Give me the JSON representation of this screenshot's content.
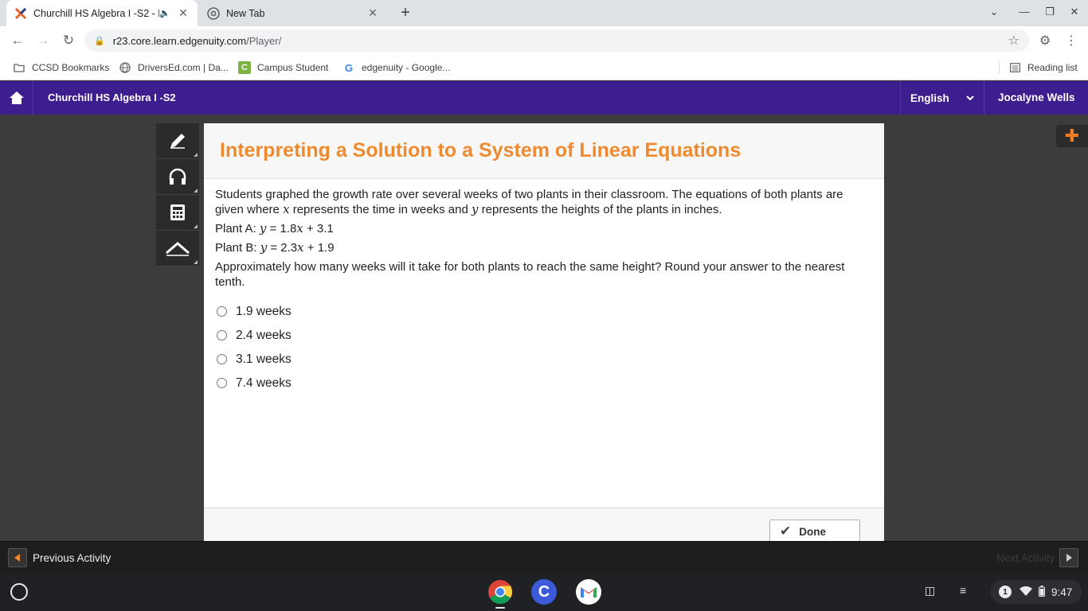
{
  "browser": {
    "tabs": [
      {
        "title": "Churchill HS Algebra I -S2 - E",
        "active": true
      },
      {
        "title": "New Tab",
        "active": false
      }
    ],
    "url_host": "r23.core.learn.edgenuity.com",
    "url_path": "/Player/",
    "bookmarks": [
      {
        "label": "CCSD Bookmarks",
        "icon": "folder-icon"
      },
      {
        "label": "DriversEd.com | Da...",
        "icon": "globe-icon"
      },
      {
        "label": "Campus Student",
        "icon": "campus-icon"
      },
      {
        "label": "edgenuity - Google...",
        "icon": "google-icon"
      }
    ],
    "reading_list": "Reading list"
  },
  "app": {
    "course_title": "Churchill HS Algebra I -S2",
    "language": "English",
    "user_name": "Jocalyne Wells",
    "accent_color": "#3d1e8e",
    "title_color": "#f08a2e"
  },
  "activity": {
    "title": "Interpreting a Solution to a System of Linear Equations",
    "intro_1": "Students graphed the growth rate over several weeks of two plants in their classroom. The equations of both plants are given where ",
    "var_x": "x",
    "intro_2": " represents the time in weeks and ",
    "var_y": "y",
    "intro_3": " represents the heights of the plants in inches.",
    "plant_a_label": "Plant A: ",
    "plant_a_eq_1": " = 1.8",
    "plant_a_eq_2": " + 3.1",
    "plant_b_label": "Plant B: ",
    "plant_b_eq_1": " = 2.3",
    "plant_b_eq_2": " + 1.9",
    "prompt": "Approximately how many weeks will it take for both plants to reach the same height? Round your answer to the nearest tenth.",
    "choices": [
      {
        "label": "1.9 weeks"
      },
      {
        "label": "2.4 weeks"
      },
      {
        "label": "3.1 weeks"
      },
      {
        "label": "7.4 weeks"
      }
    ],
    "done_label": "Done"
  },
  "nav": {
    "previous_label": "Previous Activity",
    "next_label": "Next Activity"
  },
  "system": {
    "notification_count": "1",
    "clock": "9:47"
  }
}
